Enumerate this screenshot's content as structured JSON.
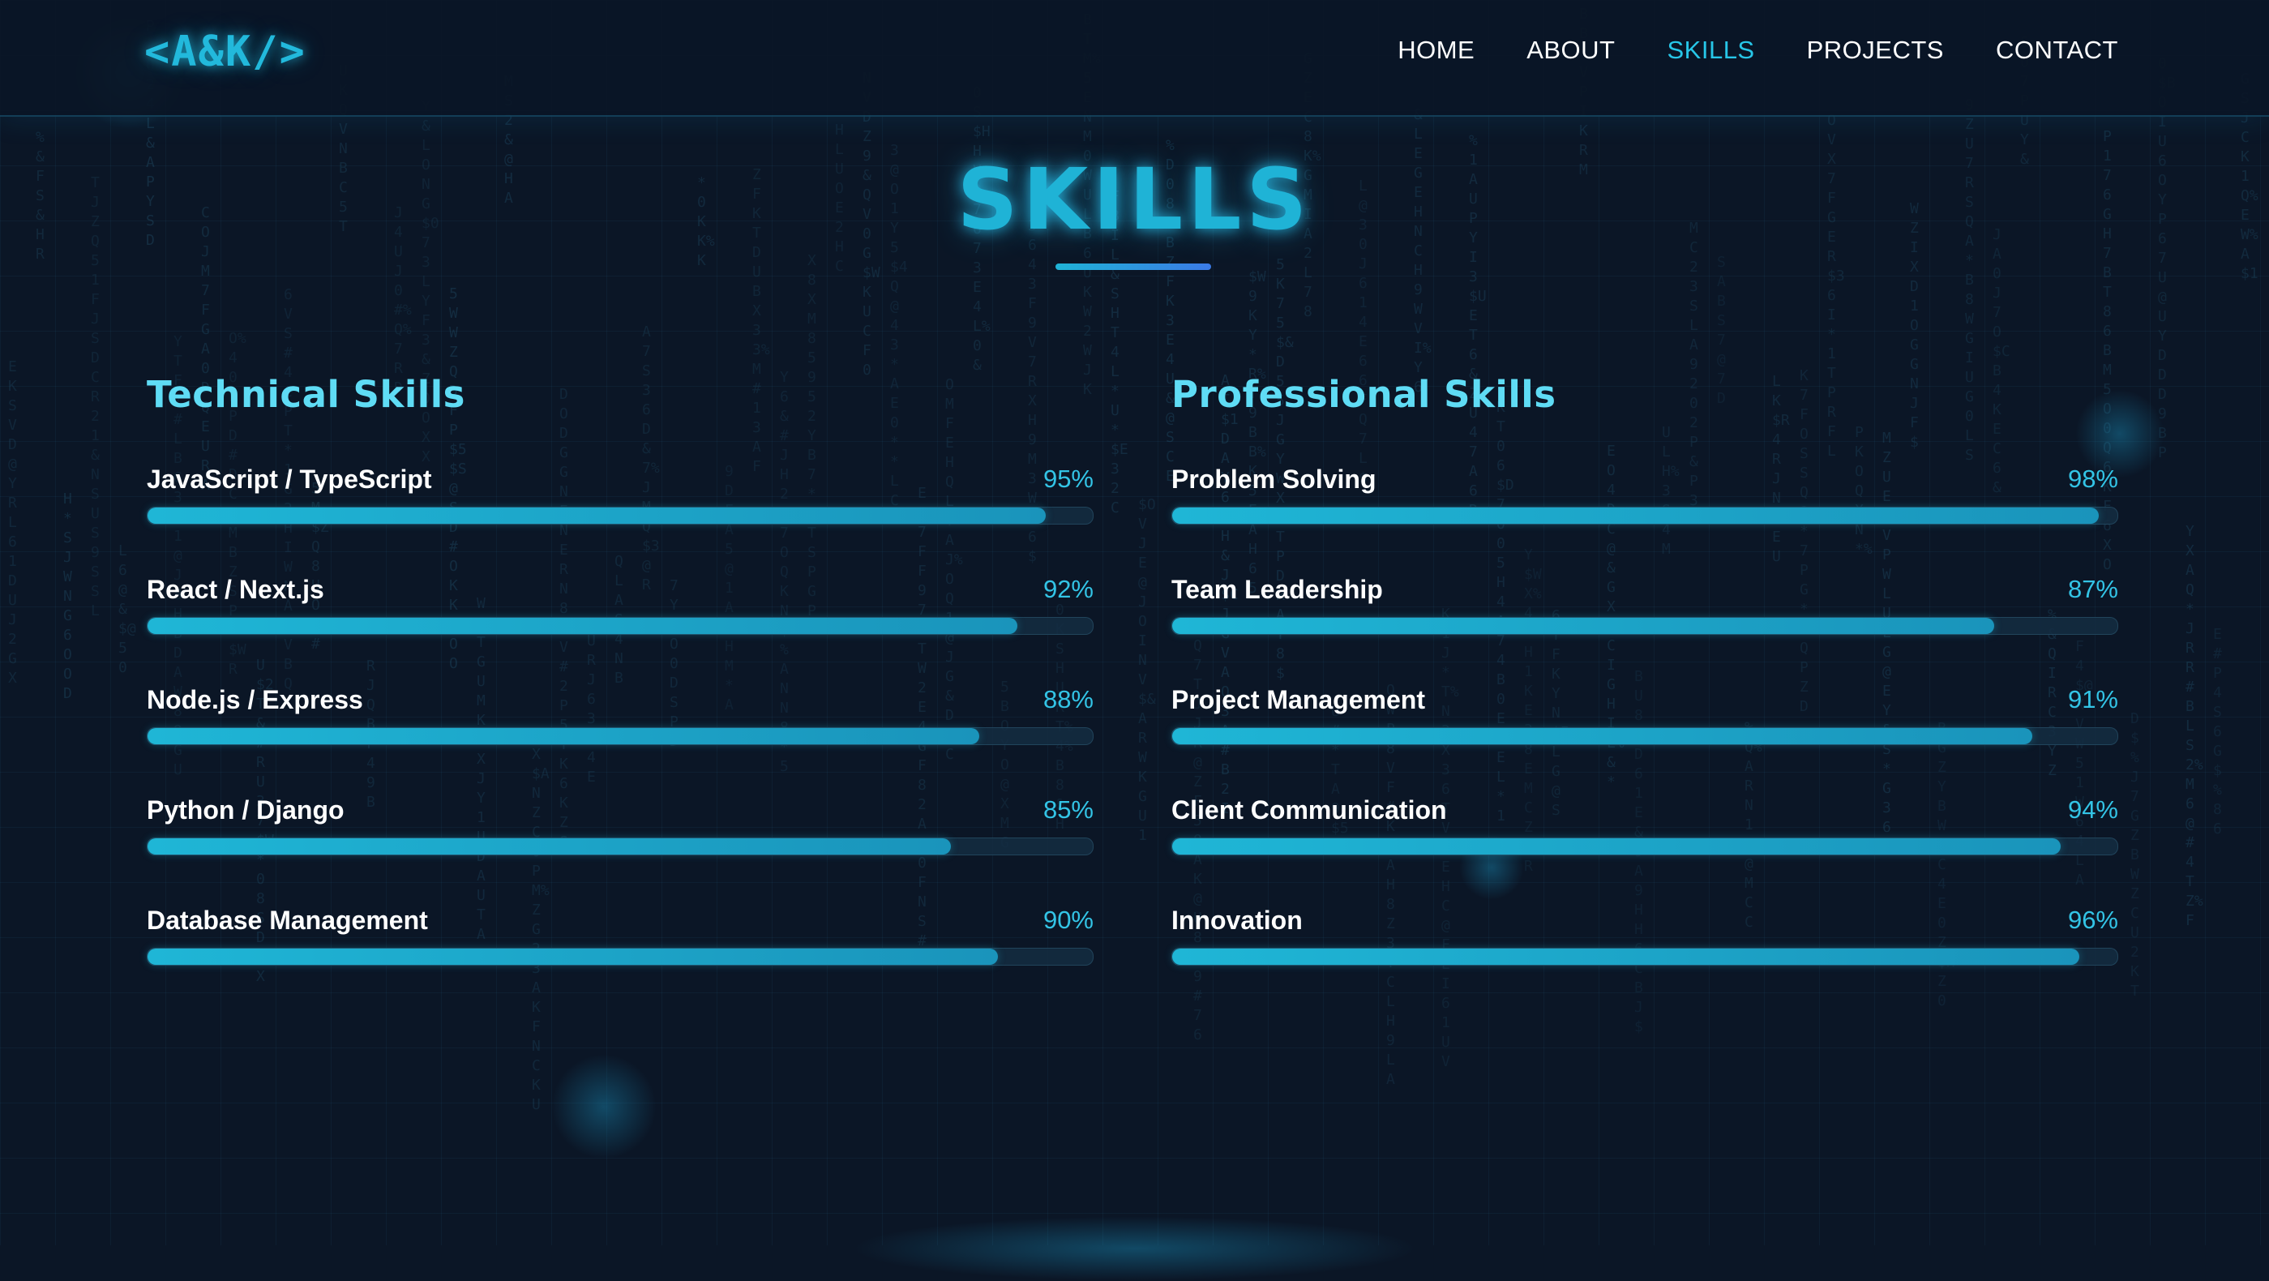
{
  "nav": {
    "logo": "<A&K/>",
    "items": [
      {
        "label": "HOME",
        "active": false
      },
      {
        "label": "ABOUT",
        "active": false
      },
      {
        "label": "SKILLS",
        "active": true
      },
      {
        "label": "PROJECTS",
        "active": false
      },
      {
        "label": "CONTACT",
        "active": false
      }
    ]
  },
  "section": {
    "title": "SKILLS"
  },
  "technical": {
    "heading": "Technical Skills",
    "skills": [
      {
        "name": "JavaScript / TypeScript",
        "percent": "95%",
        "value": 95
      },
      {
        "name": "React / Next.js",
        "percent": "92%",
        "value": 92
      },
      {
        "name": "Node.js / Express",
        "percent": "88%",
        "value": 88
      },
      {
        "name": "Python / Django",
        "percent": "85%",
        "value": 85
      },
      {
        "name": "Database Management",
        "percent": "90%",
        "value": 90
      }
    ]
  },
  "professional": {
    "heading": "Professional Skills",
    "skills": [
      {
        "name": "Problem Solving",
        "percent": "98%",
        "value": 98
      },
      {
        "name": "Team Leadership",
        "percent": "87%",
        "value": 87
      },
      {
        "name": "Project Management",
        "percent": "91%",
        "value": 91
      },
      {
        "name": "Client Communication",
        "percent": "94%",
        "value": 94
      },
      {
        "name": "Innovation",
        "percent": "96%",
        "value": 96
      }
    ]
  },
  "colors": {
    "accent": "#27c6e8",
    "background": "#0b1626",
    "bar_fill": "#1fb6d6"
  }
}
